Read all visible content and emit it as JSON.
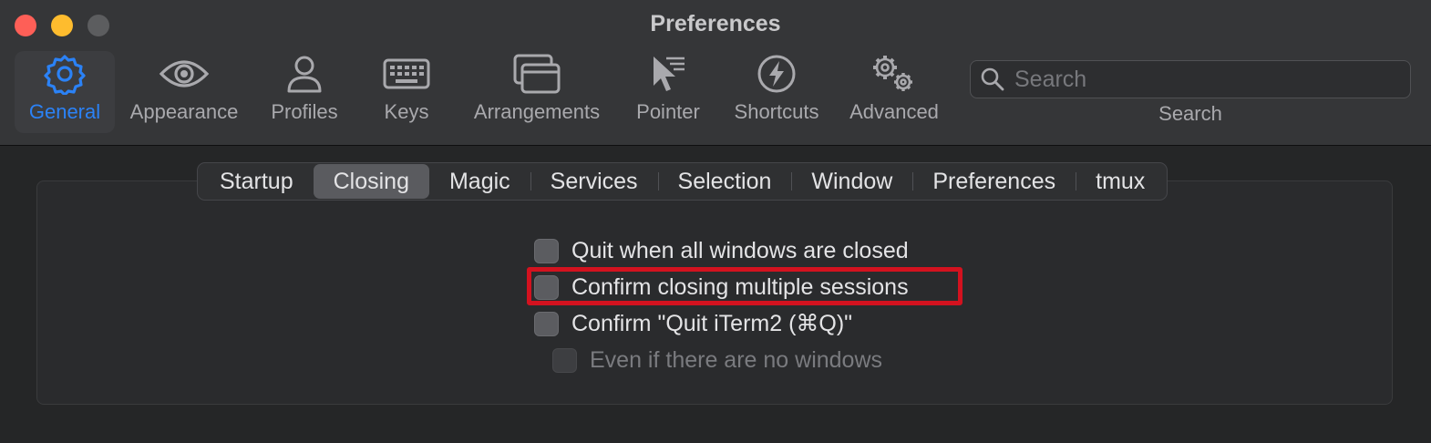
{
  "window": {
    "title": "Preferences"
  },
  "toolbar": {
    "items": [
      {
        "label": "General",
        "icon": "gear-icon",
        "active": true
      },
      {
        "label": "Appearance",
        "icon": "eye-icon"
      },
      {
        "label": "Profiles",
        "icon": "person-icon"
      },
      {
        "label": "Keys",
        "icon": "keyboard-icon"
      },
      {
        "label": "Arrangements",
        "icon": "windows-icon"
      },
      {
        "label": "Pointer",
        "icon": "pointer-icon"
      },
      {
        "label": "Shortcuts",
        "icon": "lightning-icon"
      },
      {
        "label": "Advanced",
        "icon": "gears-icon"
      }
    ],
    "search": {
      "placeholder": "Search",
      "caption": "Search"
    }
  },
  "tabs": [
    "Startup",
    "Closing",
    "Magic",
    "Services",
    "Selection",
    "Window",
    "Preferences",
    "tmux"
  ],
  "selected_tab": "Closing",
  "options": [
    {
      "label": "Quit when all windows are closed",
      "checked": false,
      "enabled": true
    },
    {
      "label": "Confirm closing multiple sessions",
      "checked": false,
      "enabled": true,
      "highlighted": true
    },
    {
      "label": "Confirm \"Quit iTerm2 (⌘Q)\"",
      "checked": false,
      "enabled": true
    },
    {
      "label": "Even if there are no windows",
      "checked": false,
      "enabled": false
    }
  ],
  "colors": {
    "accent": "#2b82f6",
    "highlight_box": "#d3121f",
    "close": "#fe5f57",
    "minimize": "#febc2e"
  }
}
